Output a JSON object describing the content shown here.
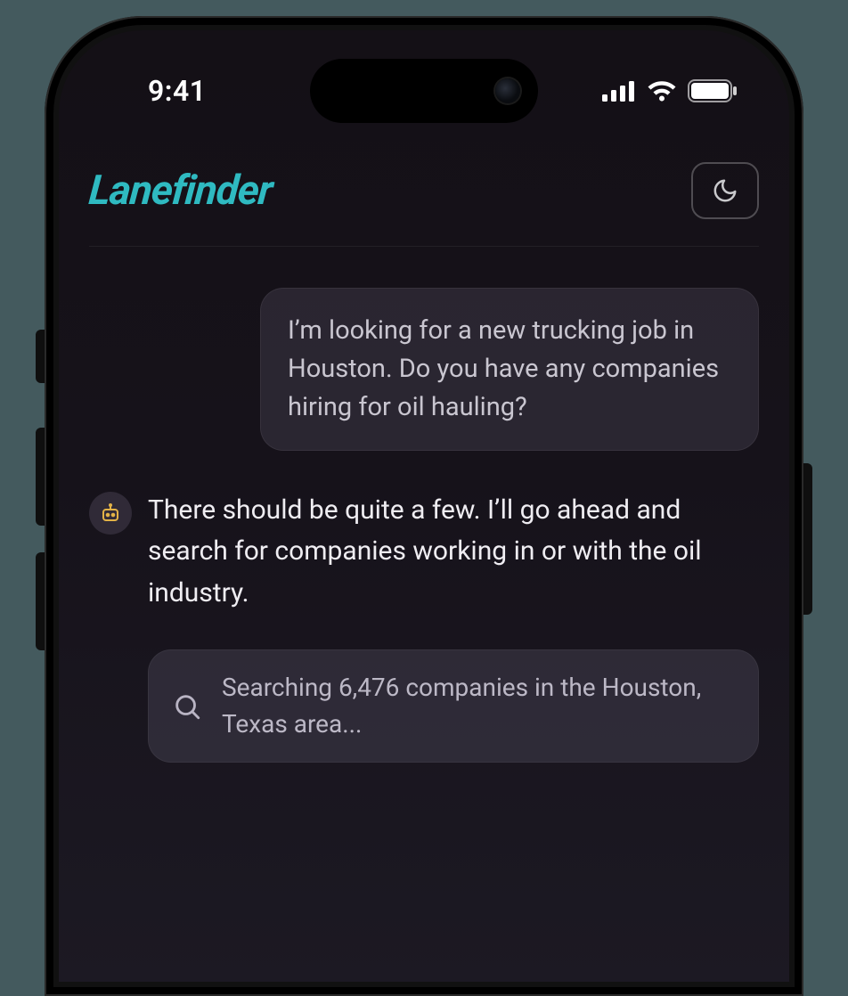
{
  "status_bar": {
    "time": "9:41"
  },
  "header": {
    "brand": "Lanefinder"
  },
  "chat": {
    "user_message": "I’m looking for a new trucking job in Houston. Do you have any companies hiring for oil hauling?",
    "assistant_message": "There should be quite a few. I’ll go ahead and search for companies working in or with the oil industry.",
    "search_status": "Searching 6,476 companies in the Houston, Texas area..."
  }
}
